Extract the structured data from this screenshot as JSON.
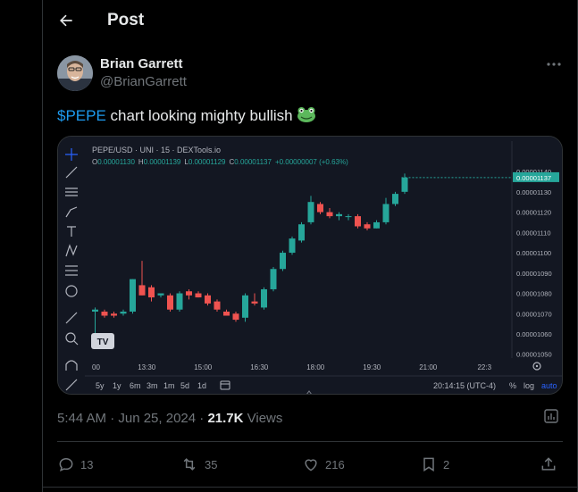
{
  "header": {
    "title": "Post",
    "back_icon": "arrow-left-icon"
  },
  "tweet": {
    "author_name": "Brian Garrett",
    "author_handle": "@BrianGarrett",
    "cashtag": "$PEPE",
    "text": " chart looking mighty bullish",
    "emoji": "frog-icon",
    "time": "5:44 AM · Jun 25, 2024 · ",
    "views_count": "21.7K",
    "views_label": " Views"
  },
  "actions": {
    "replies": "13",
    "reposts": "35",
    "likes": "216",
    "bookmarks": "2"
  },
  "colors": {
    "accent": "#1d9bf0",
    "up": "#26a69a",
    "down": "#ef5350",
    "chart_bg": "#131722"
  },
  "chart_data": {
    "type": "candlestick",
    "title": "PEPE/USD · UNI · 15 · DEXTools.io",
    "ohlc_label": {
      "o": "O",
      "o_val": "0.00001130",
      "h": "H",
      "h_val": "0.00001139",
      "l": "L",
      "l_val": "0.00001129",
      "c": "C",
      "c_val": "0.00001137",
      "chg": "+0.00000007 (+0.63%)"
    },
    "last_price": "0.00001137",
    "y_ticks": [
      "0.00001140",
      "0.00001130",
      "0.00001120",
      "0.00001110",
      "0.00001100",
      "0.00001090",
      "0.00001080",
      "0.00001070",
      "0.00001060",
      "0.00001050"
    ],
    "y_tick_values": [
      11.4,
      11.3,
      11.2,
      11.1,
      11.0,
      10.9,
      10.8,
      10.7,
      10.6,
      10.5
    ],
    "ylim": [
      10.49,
      11.44
    ],
    "y_scale_note": "values in units of 1e-6",
    "x_ticks": [
      "00",
      "13:30",
      "15:00",
      "16:30",
      "18:00",
      "19:30",
      "21:00",
      "22:3"
    ],
    "x_tick_index": [
      0,
      5.5,
      11.5,
      17.5,
      23.5,
      29.5,
      35.5,
      41.5
    ],
    "candles": [
      {
        "o": 10.71,
        "h": 10.73,
        "l": 10.59,
        "c": 10.72
      },
      {
        "o": 10.71,
        "h": 10.72,
        "l": 10.68,
        "c": 10.69
      },
      {
        "o": 10.7,
        "h": 10.71,
        "l": 10.68,
        "c": 10.69
      },
      {
        "o": 10.7,
        "h": 10.72,
        "l": 10.69,
        "c": 10.71
      },
      {
        "o": 10.71,
        "h": 10.8,
        "l": 10.7,
        "c": 10.87
      },
      {
        "o": 10.84,
        "h": 10.96,
        "l": 10.8,
        "c": 10.79
      },
      {
        "o": 10.83,
        "h": 10.84,
        "l": 10.76,
        "c": 10.78
      },
      {
        "o": 10.79,
        "h": 10.8,
        "l": 10.78,
        "c": 10.8
      },
      {
        "o": 10.79,
        "h": 10.8,
        "l": 10.71,
        "c": 10.72
      },
      {
        "o": 10.72,
        "h": 10.81,
        "l": 10.71,
        "c": 10.8
      },
      {
        "o": 10.81,
        "h": 10.82,
        "l": 10.77,
        "c": 10.79
      },
      {
        "o": 10.8,
        "h": 10.81,
        "l": 10.78,
        "c": 10.78
      },
      {
        "o": 10.79,
        "h": 10.8,
        "l": 10.74,
        "c": 10.75
      },
      {
        "o": 10.76,
        "h": 10.77,
        "l": 10.71,
        "c": 10.72
      },
      {
        "o": 10.71,
        "h": 10.72,
        "l": 10.69,
        "c": 10.69
      },
      {
        "o": 10.7,
        "h": 10.71,
        "l": 10.66,
        "c": 10.67
      },
      {
        "o": 10.68,
        "h": 10.8,
        "l": 10.66,
        "c": 10.79
      },
      {
        "o": 10.76,
        "h": 10.8,
        "l": 10.74,
        "c": 10.75
      },
      {
        "o": 10.73,
        "h": 10.83,
        "l": 10.72,
        "c": 10.82
      },
      {
        "o": 10.82,
        "h": 10.93,
        "l": 10.81,
        "c": 10.92
      },
      {
        "o": 10.92,
        "h": 11.01,
        "l": 10.91,
        "c": 11.0
      },
      {
        "o": 11.0,
        "h": 11.08,
        "l": 10.99,
        "c": 11.07
      },
      {
        "o": 11.06,
        "h": 11.15,
        "l": 11.05,
        "c": 11.14
      },
      {
        "o": 11.15,
        "h": 11.28,
        "l": 11.14,
        "c": 11.25
      },
      {
        "o": 11.24,
        "h": 11.25,
        "l": 11.19,
        "c": 11.2
      },
      {
        "o": 11.2,
        "h": 11.22,
        "l": 11.17,
        "c": 11.18
      },
      {
        "o": 11.18,
        "h": 11.2,
        "l": 11.16,
        "c": 11.19
      },
      {
        "o": 11.18,
        "h": 11.19,
        "l": 11.16,
        "c": 11.18
      },
      {
        "o": 11.18,
        "h": 11.19,
        "l": 11.12,
        "c": 11.13
      },
      {
        "o": 11.14,
        "h": 11.15,
        "l": 11.11,
        "c": 11.12
      },
      {
        "o": 11.12,
        "h": 11.16,
        "l": 11.12,
        "c": 11.15
      },
      {
        "o": 11.15,
        "h": 11.27,
        "l": 11.14,
        "c": 11.24
      },
      {
        "o": 11.24,
        "h": 11.3,
        "l": 11.23,
        "c": 11.29
      },
      {
        "o": 11.3,
        "h": 11.39,
        "l": 11.29,
        "c": 11.37
      }
    ],
    "timeframes": [
      "5y",
      "1y",
      "6m",
      "3m",
      "1m",
      "5d",
      "1d"
    ],
    "bottom_right": {
      "clock": "20:14:15 (UTC-4)",
      "pct": "%",
      "log": "log",
      "auto": "auto"
    },
    "watermark": "TV",
    "grid": false
  }
}
